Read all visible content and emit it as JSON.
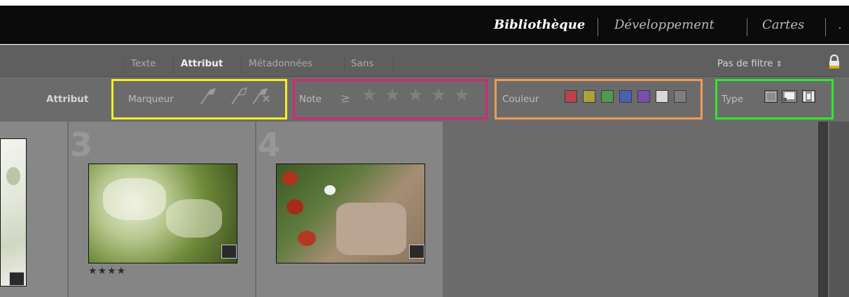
{
  "modules": {
    "items": [
      {
        "label": "Bibliothèque",
        "active": true
      },
      {
        "label": "Développement",
        "active": false
      },
      {
        "label": "Cartes",
        "active": false
      }
    ]
  },
  "filter_bar": {
    "tabs": [
      {
        "label": "Texte",
        "active": false
      },
      {
        "label": "Attribut",
        "active": true
      },
      {
        "label": "Métadonnées",
        "active": false
      },
      {
        "label": "Sans",
        "active": false
      }
    ],
    "preset_label": "Pas de filtre",
    "preset_arrow": "⇕",
    "lock_icon": "padlock-icon"
  },
  "attribute_bar": {
    "title": "Attribut",
    "flag": {
      "label": "Marqueur",
      "icons": [
        "flag-picked-icon",
        "flag-unflagged-icon",
        "flag-rejected-icon"
      ]
    },
    "rating": {
      "label": "Note",
      "operator": "≥",
      "stars": 5
    },
    "color": {
      "label": "Couleur",
      "swatches": [
        "#b8434a",
        "#aaa33a",
        "#4d9a50",
        "#4a5fb0",
        "#7a4eb0",
        "#d8d8d8",
        "#7e7e7e"
      ]
    },
    "kind": {
      "label": "Type",
      "icons": [
        "master-photo-icon",
        "virtual-copy-icon",
        "video-icon"
      ]
    }
  },
  "highlight_colors": {
    "flag": "#f4ee27",
    "rating": "#d42677",
    "color": "#f39a52",
    "kind": "#2ee82b"
  },
  "grid": {
    "cells": [
      {
        "number": "",
        "stars": ""
      },
      {
        "number": "3",
        "stars": "★★★★"
      },
      {
        "number": "4",
        "stars": ""
      }
    ]
  }
}
